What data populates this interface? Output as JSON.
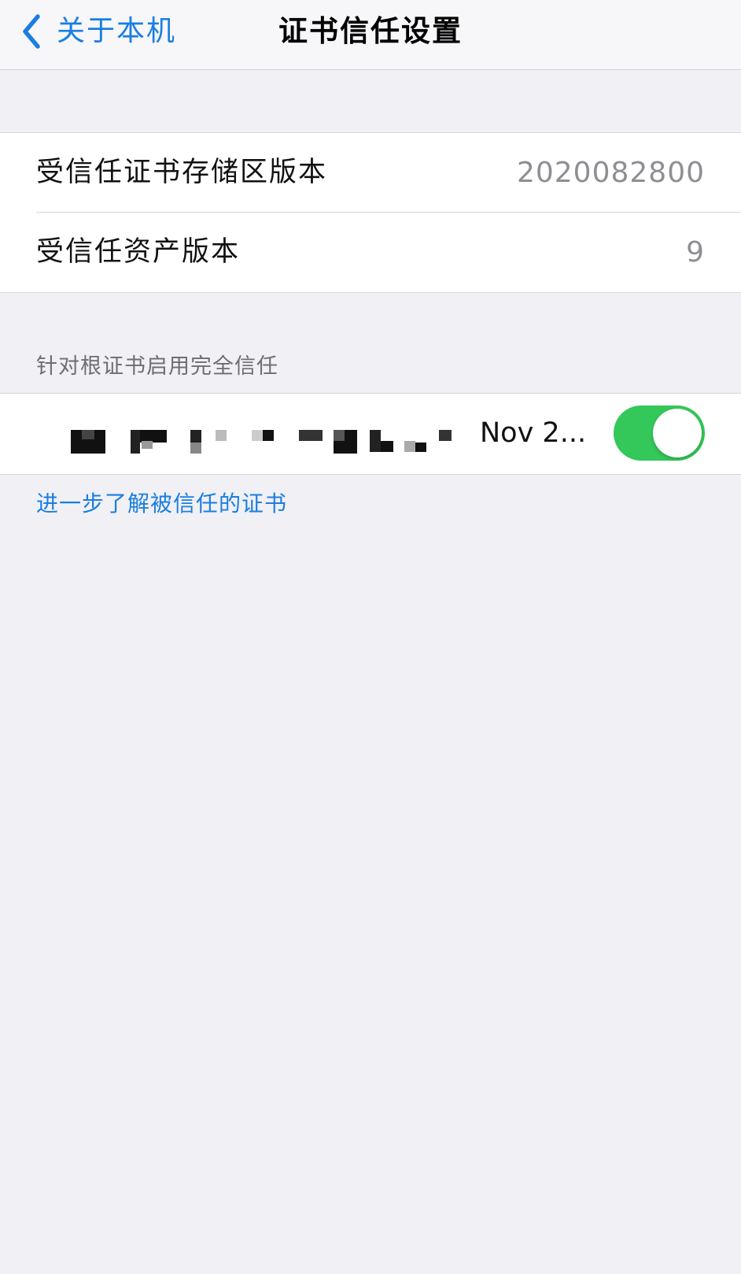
{
  "navbar": {
    "back_label": "关于本机",
    "back_icon": "chevron-left-icon",
    "title": "证书信任设置"
  },
  "versions": [
    {
      "label": "受信任证书存储区版本",
      "value": "2020082800"
    },
    {
      "label": "受信任资产版本",
      "value": "9"
    }
  ],
  "root_trust": {
    "header": "针对根证书启用完全信任",
    "certificate": {
      "name_obscured": true,
      "date": "Nov 2...",
      "trust_enabled": true
    }
  },
  "footer": {
    "learn_more": "进一步了解被信任的证书"
  },
  "colors": {
    "accent": "#1a7ee0",
    "toggle_on": "#34c759",
    "background": "#f0f0f5",
    "secondary_text": "#8e8e93"
  }
}
